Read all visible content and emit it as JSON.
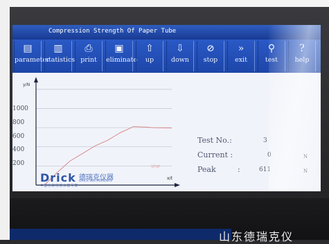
{
  "window": {
    "title": "Compression Strength Of Paper Tube"
  },
  "toolbar": {
    "buttons": [
      {
        "label": "parameter",
        "icon": "document-icon"
      },
      {
        "label": "statistics",
        "icon": "bar-chart-icon"
      },
      {
        "label": "print",
        "icon": "printer-icon"
      },
      {
        "label": "eliminate",
        "icon": "trash-icon"
      },
      {
        "label": "up",
        "icon": "arrow-up-icon"
      },
      {
        "label": "down",
        "icon": "arrow-down-icon"
      },
      {
        "label": "stop",
        "icon": "stop-icon"
      },
      {
        "label": "exit",
        "icon": "chevron-right-icon"
      },
      {
        "label": "test",
        "icon": "magnifier-icon"
      },
      {
        "label": "help",
        "icon": "help-icon"
      }
    ]
  },
  "chart": {
    "y_axis_title": "y/N",
    "x_axis_title": "x/t",
    "y_ticks": [
      "1000",
      "800",
      "600",
      "400",
      "200"
    ],
    "stop_label": "STOP"
  },
  "chart_data": {
    "type": "line",
    "ylabel": "y/N",
    "xlabel": "x/t",
    "ylim": [
      0,
      1100
    ],
    "xlim": [
      0,
      100
    ],
    "grid": true,
    "series": [
      {
        "x": [
          0,
          10,
          20,
          30,
          40,
          50,
          55,
          60,
          65,
          70,
          80,
          85,
          90,
          95,
          100
        ],
        "y": [
          0,
          130,
          250,
          330,
          410,
          470,
          510,
          550,
          580,
          611,
          605,
          600,
          598,
          597,
          596
        ]
      }
    ]
  },
  "logo": {
    "brand": "Drick",
    "chinese": "德瑞克仪器",
    "sub": "DRICK INSTRUMENTS",
    "tagline": "中国包装检测仪器专家"
  },
  "readout": {
    "test_no_label": "Test No.:",
    "test_no_value": "3",
    "current_label": "Current :",
    "current_value": "0",
    "current_unit": "N",
    "peak_label": "Peak",
    "peak_colon": ":",
    "peak_value": "611",
    "peak_unit": "N"
  },
  "device": {
    "brand_text": "山东德瑞克仪"
  },
  "colors": {
    "toolbar": "#1d46a8",
    "screen": "#f1f3fa",
    "curve": "#d88a8a"
  }
}
